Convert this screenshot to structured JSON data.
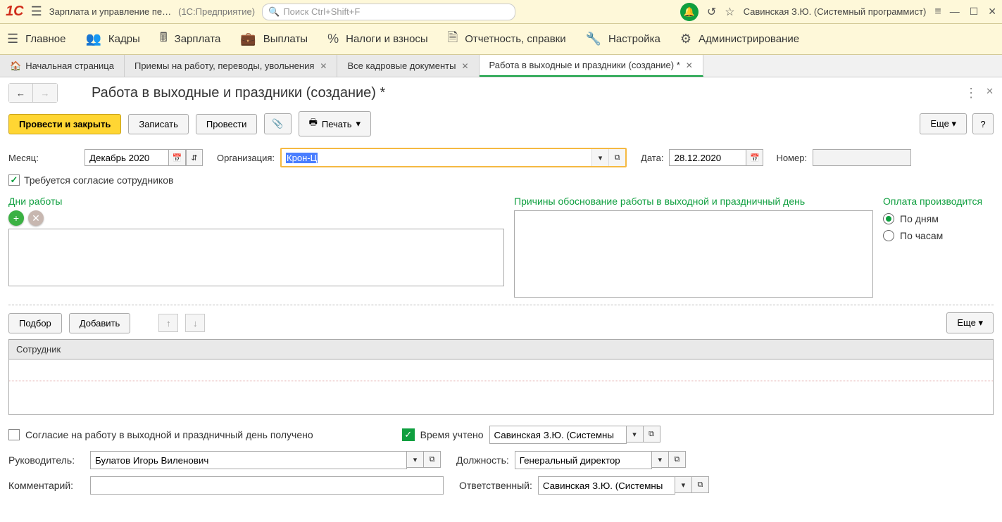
{
  "top": {
    "app_title": "Зарплата и управление пе…",
    "app_subtitle": "(1С:Предприятие)",
    "search_placeholder": "Поиск Ctrl+Shift+F",
    "user": "Савинская З.Ю. (Системный программист)"
  },
  "nav": {
    "items": [
      "Главное",
      "Кадры",
      "Зарплата",
      "Выплаты",
      "Налоги и взносы",
      "Отчетность, справки",
      "Настройка",
      "Администрирование"
    ]
  },
  "tabs": {
    "home": "Начальная страница",
    "items": [
      {
        "label": "Приемы на работу, переводы, увольнения",
        "active": false
      },
      {
        "label": "Все кадровые документы",
        "active": false
      },
      {
        "label": "Работа в выходные и праздники (создание) *",
        "active": true
      }
    ]
  },
  "doc": {
    "title": "Работа в выходные и праздники (создание) *"
  },
  "toolbar": {
    "post_close": "Провести и закрыть",
    "save": "Записать",
    "post": "Провести",
    "print": "Печать",
    "more": "Еще",
    "help": "?"
  },
  "fields": {
    "month_label": "Месяц:",
    "month_value": "Декабрь 2020",
    "org_label": "Организация:",
    "org_value": "Крон-Ц",
    "date_label": "Дата:",
    "date_value": "28.12.2020",
    "number_label": "Номер:",
    "number_value": "",
    "consent_label": "Требуется согласие сотрудников"
  },
  "sections": {
    "days": "Дни работы",
    "reasons": "Причины обоснование работы в выходной и праздничный день",
    "payment": "Оплата производится",
    "by_days": "По дням",
    "by_hours": "По часам"
  },
  "table": {
    "select_btn": "Подбор",
    "add_btn": "Добавить",
    "more": "Еще",
    "col_employee": "Сотрудник"
  },
  "bottom": {
    "consent_received": "Согласие на работу в выходной и праздничный день получено",
    "time_accounted": "Время учтено",
    "time_user": "Савинская З.Ю. (Системны",
    "manager_label": "Руководитель:",
    "manager_value": "Булатов Игорь Виленович",
    "position_label": "Должность:",
    "position_value": "Генеральный директор",
    "comment_label": "Комментарий:",
    "comment_value": "",
    "responsible_label": "Ответственный:",
    "responsible_value": "Савинская З.Ю. (Системны"
  }
}
